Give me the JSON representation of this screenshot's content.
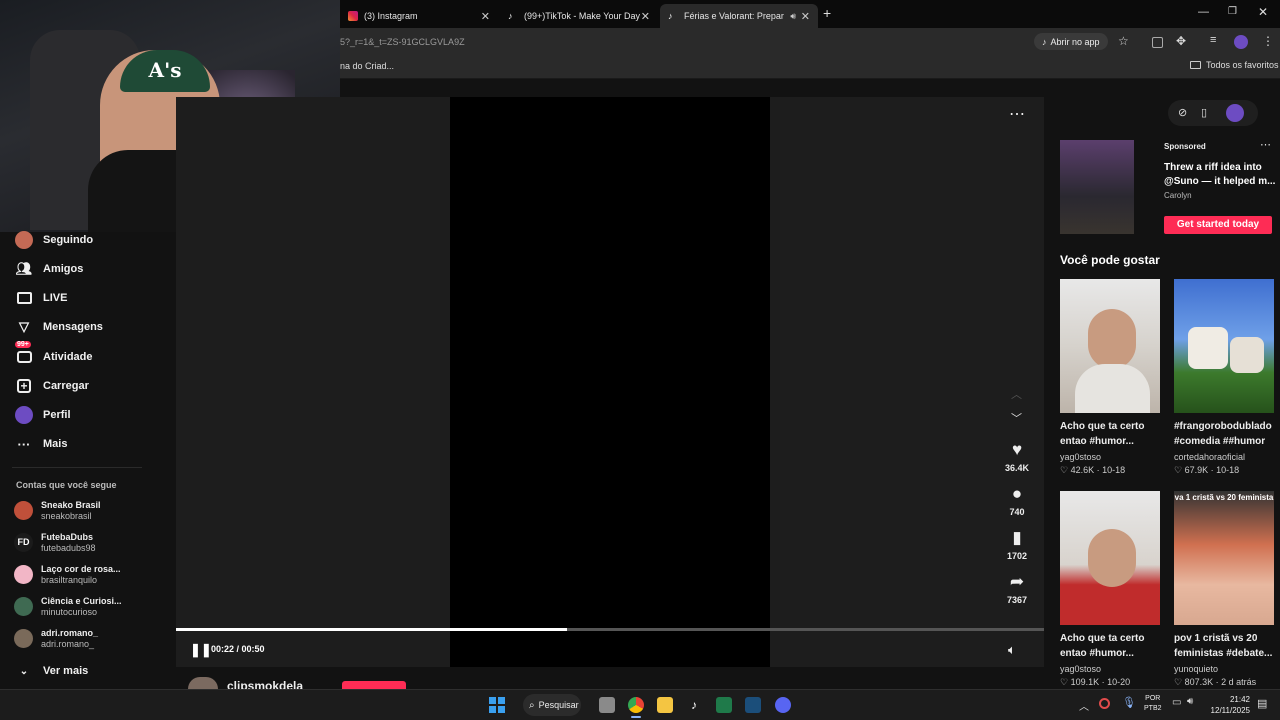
{
  "browser": {
    "tabs": [
      {
        "label": "(3) Instagram",
        "color": "#e1306c"
      },
      {
        "label": "(99+)TikTok - Make Your Day",
        "color": "#ffffff"
      },
      {
        "label": "Férias e Valorant: Prepare-s",
        "color": "#ffffff"
      }
    ],
    "url": "5?_r=1&_t=ZS-91GCLGVLA9Z",
    "open_in_app": "Abrir no app",
    "bookmark_partial": "na do Criad...",
    "all_favorites": "Todos os favoritos"
  },
  "sidebar": {
    "nav": [
      {
        "label": "Seguindo",
        "icon": "following-icon"
      },
      {
        "label": "Amigos",
        "icon": "friends-icon"
      },
      {
        "label": "LIVE",
        "icon": "live-icon"
      },
      {
        "label": "Mensagens",
        "icon": "messages-icon"
      },
      {
        "label": "Atividade",
        "icon": "activity-icon",
        "badge": "99+"
      },
      {
        "label": "Carregar",
        "icon": "upload-icon"
      },
      {
        "label": "Perfil",
        "icon": "profile-icon"
      },
      {
        "label": "Mais",
        "icon": "more-icon"
      }
    ],
    "following_title": "Contas que você segue",
    "accounts": [
      {
        "name": "Sneako Brasil",
        "handle": "sneakobrasil",
        "color": "#c0503a"
      },
      {
        "name": "FutebaDubs",
        "handle": "futebadubs98",
        "color": "#1b1b1b"
      },
      {
        "name": "Laço cor de rosa...",
        "handle": "brasiltranquilo",
        "color": "#f2b6c6"
      },
      {
        "name": "Ciência e Curiosi...",
        "handle": "minutocurioso",
        "color": "#3f6a52"
      },
      {
        "name": "adri.romano_",
        "handle": "adri.romano_",
        "color": "#7a6a5a"
      }
    ],
    "see_more": "Ver mais"
  },
  "player": {
    "time": "00:22 / 00:50",
    "progress": 0.45,
    "author_partial": "clipsmokdela",
    "likes": "36.4K",
    "comments": "740",
    "saves": "1702",
    "shares": "7367"
  },
  "ad": {
    "sponsored": "Sponsored",
    "title": "Threw a riff idea into @Suno — it helped m...",
    "author": "Carolyn",
    "cta": "Get started today"
  },
  "recommend": {
    "title": "Você pode gostar",
    "items": [
      {
        "title": "Acho que ta certo entao #humor...",
        "author": "yag0stoso",
        "stats": "42.6K · 10-18"
      },
      {
        "title": "#frangorobodublado #comedia ##humor",
        "author": "cortedahoraoficial",
        "stats": "67.9K · 10-18"
      },
      {
        "title": "Acho que ta certo entao #humor...",
        "author": "yag0stoso",
        "stats": "109.1K · 10-20"
      },
      {
        "title": "pov 1 cristã vs 20 feministas #debate...",
        "author": "yunoquieto",
        "stats": "807.3K · 2 d atrás"
      }
    ],
    "thumb_overlay": "va 1 cristã vs 20 feminista"
  },
  "taskbar": {
    "search": "Pesquisar",
    "lang": "POR",
    "layout": "PTB2",
    "time": "21:42",
    "date": "12/11/2025"
  }
}
